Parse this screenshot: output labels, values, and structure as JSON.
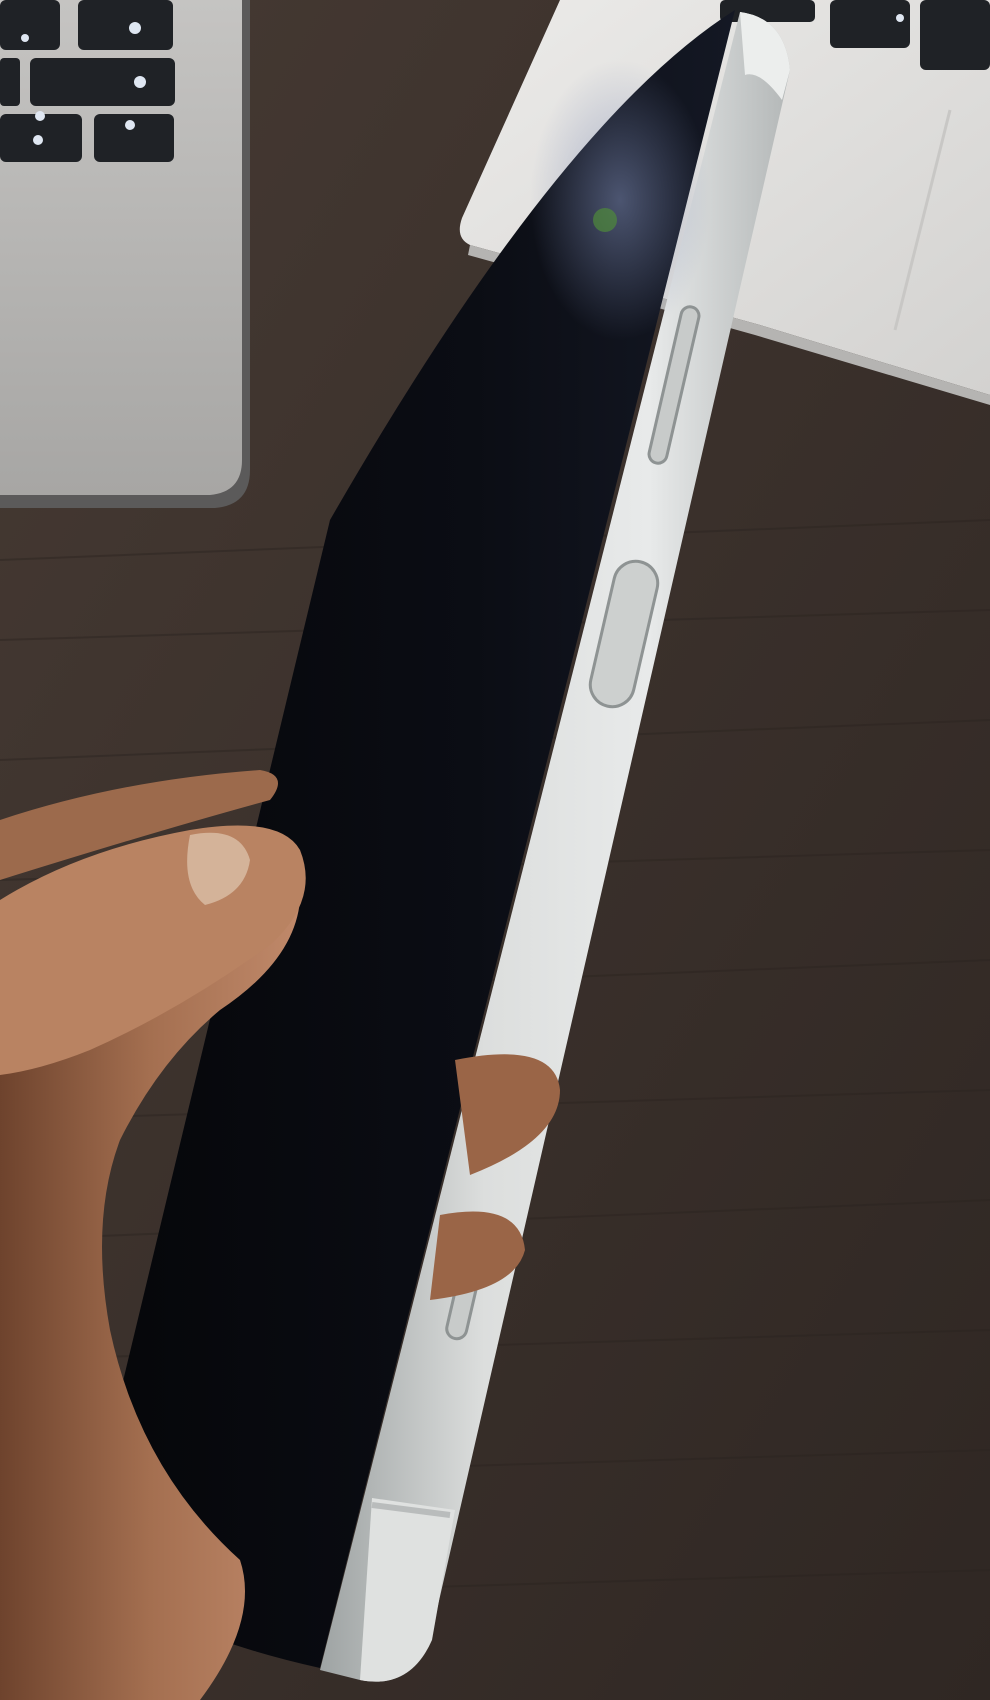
{
  "scene": {
    "subject": "smartphone-side-view",
    "colors": {
      "desk": "#3a302b",
      "desk_grain": "#2b2420",
      "laptop_body": "#b9b8b6",
      "laptop_edge": "#5b5a5a",
      "key": "#1f2226",
      "key_light": "#dfe7f2",
      "second_laptop": "#e3e2e0",
      "phone_screen": "#07080c",
      "phone_frame": "#d7d9d8",
      "phone_frame_shadow": "#a9adac",
      "skin": "#b07c5c",
      "skin_dark": "#7b4e35",
      "nail": "#d7b8a0"
    }
  }
}
